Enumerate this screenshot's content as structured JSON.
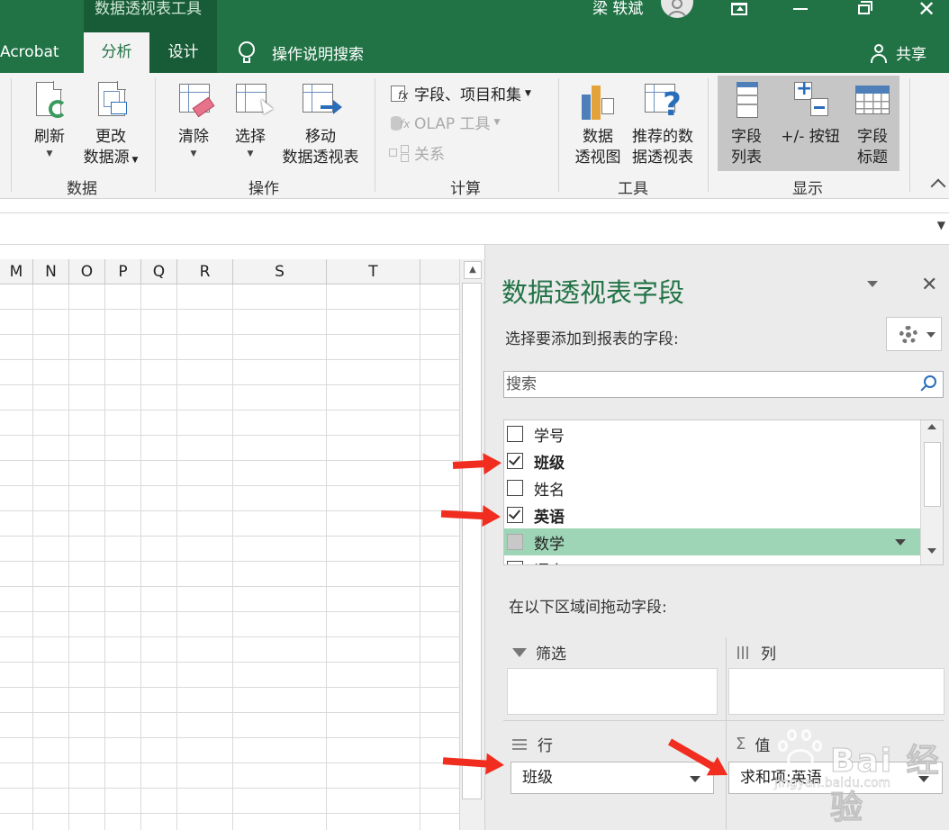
{
  "title_bar": {
    "tools_label": "数据透视表工具",
    "user_name": "梁 轶斌"
  },
  "tabs": {
    "acrobat": "Acrobat",
    "analyze": "分析",
    "design": "设计",
    "tell_me": "操作说明搜索",
    "share": "共享"
  },
  "ribbon": {
    "groups": {
      "data": "数据",
      "actions": "操作",
      "calculations": "计算",
      "tools": "工具",
      "show": "显示"
    },
    "refresh": "刷新",
    "change_source_line1": "更改",
    "change_source_line2": "数据源",
    "clear": "清除",
    "select": "选择",
    "move_line1": "移动",
    "move_line2": "数据透视表",
    "fields_items_sets": "字段、项目和集",
    "olap_tools": "OLAP 工具",
    "relationships": "关系",
    "pivotchart_line1": "数据",
    "pivotchart_line2": "透视图",
    "recommended_line1": "推荐的数",
    "recommended_line2": "据透视表",
    "field_list_line1": "字段",
    "field_list_line2": "列表",
    "buttons": "+/- 按钮",
    "headers_line1": "字段",
    "headers_line2": "标题"
  },
  "sheet": {
    "columns": [
      "M",
      "N",
      "O",
      "P",
      "Q",
      "R",
      "S",
      "T"
    ]
  },
  "pane": {
    "title": "数据透视表字段",
    "choose_label": "选择要添加到报表的字段:",
    "search_placeholder": "搜索",
    "fields": [
      {
        "label": "学号",
        "checked": false
      },
      {
        "label": "班级",
        "checked": true
      },
      {
        "label": "姓名",
        "checked": false
      },
      {
        "label": "英语",
        "checked": true
      },
      {
        "label": "数学",
        "checked": false
      },
      {
        "label": "语文",
        "checked": false
      }
    ],
    "drag_label": "在以下区域间拖动字段:",
    "areas": {
      "filter": "筛选",
      "columns": "列",
      "rows": "行",
      "values": "值"
    },
    "rows_chip": "班级",
    "values_chip": "求和项:英语"
  },
  "watermark": {
    "text": "Bai 经验",
    "url": "jingyan.baidu.com"
  },
  "colors": {
    "excel_green": "#217346",
    "dark_green": "#185c37",
    "highlight": "#9fd5b7",
    "arrow_red": "#f02d1f"
  }
}
